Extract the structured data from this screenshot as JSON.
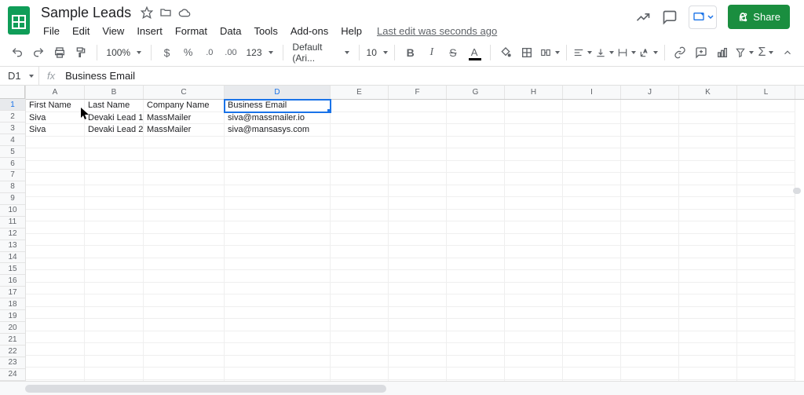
{
  "doc": {
    "title": "Sample Leads"
  },
  "menus": {
    "file": "File",
    "edit": "Edit",
    "view": "View",
    "insert": "Insert",
    "format": "Format",
    "data": "Data",
    "tools": "Tools",
    "addons": "Add-ons",
    "help": "Help",
    "last_edit": "Last edit was seconds ago"
  },
  "share": {
    "label": "Share"
  },
  "toolbar": {
    "zoom": "100%",
    "font": "Default (Ari...",
    "font_size": "10",
    "decimal_dec": ".0",
    "decimal_inc": ".00",
    "num_format": "123"
  },
  "name_box": "D1",
  "fx_label": "fx",
  "formula_value": "Business Email",
  "cols": {
    "widths": [
      75,
      75,
      103,
      135,
      74,
      74,
      74,
      74,
      74,
      74,
      74,
      74
    ],
    "labels": [
      "A",
      "B",
      "C",
      "D",
      "E",
      "F",
      "G",
      "H",
      "I",
      "J",
      "K",
      "L"
    ]
  },
  "selected": {
    "col": 3,
    "row": 0
  },
  "grid": {
    "num_rows": 24,
    "rows": [
      [
        "First Name",
        "Last Name",
        "Company Name",
        "Business Email",
        "",
        "",
        "",
        "",
        "",
        "",
        "",
        ""
      ],
      [
        "Siva",
        "Devaki Lead 1",
        "MassMailer",
        "siva@massmailer.io",
        "",
        "",
        "",
        "",
        "",
        "",
        "",
        ""
      ],
      [
        "Siva",
        "Devaki Lead 2",
        "MassMailer",
        "siva@mansasys.com",
        "",
        "",
        "",
        "",
        "",
        "",
        "",
        ""
      ]
    ]
  }
}
